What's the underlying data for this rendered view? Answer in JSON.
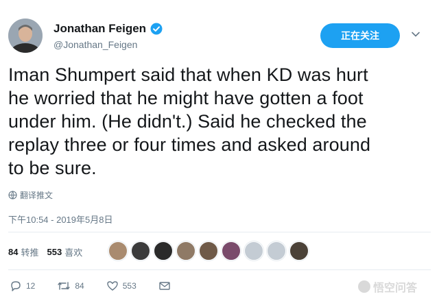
{
  "user": {
    "display_name": "Jonathan Feigen",
    "handle": "@Jonathan_Feigen"
  },
  "follow_button": {
    "label": "正在关注"
  },
  "tweet": {
    "text": "Iman Shumpert said that when KD was hurt\nhe worried that he might have gotten a foot\nunder him. (He didn't.) Said he checked the\nreplay three or four times and asked around\nto be sure.",
    "translate_label": "翻译推文",
    "timestamp": "下午10:54 - 2019年5月8日"
  },
  "stats": {
    "retweets": "84",
    "retweets_label": "转推",
    "likes": "553",
    "likes_label": "喜欢"
  },
  "likers": [
    {
      "color": "#a98b6f"
    },
    {
      "color": "#3b3b3b"
    },
    {
      "color": "#2a2a2a"
    },
    {
      "color": "#8f7a66"
    },
    {
      "color": "#6f5a48"
    },
    {
      "color": "#7a4b6b"
    },
    {
      "color": "#c4ccd4"
    },
    {
      "color": "#c4ccd4"
    },
    {
      "color": "#4b4238"
    }
  ],
  "actions": {
    "reply_count": "12",
    "retweet_count": "84",
    "like_count": "553"
  },
  "watermark": {
    "text": "悟空问答"
  },
  "colors": {
    "accent": "#1da1f2",
    "muted": "#657786",
    "divider": "#e6ecf0"
  }
}
